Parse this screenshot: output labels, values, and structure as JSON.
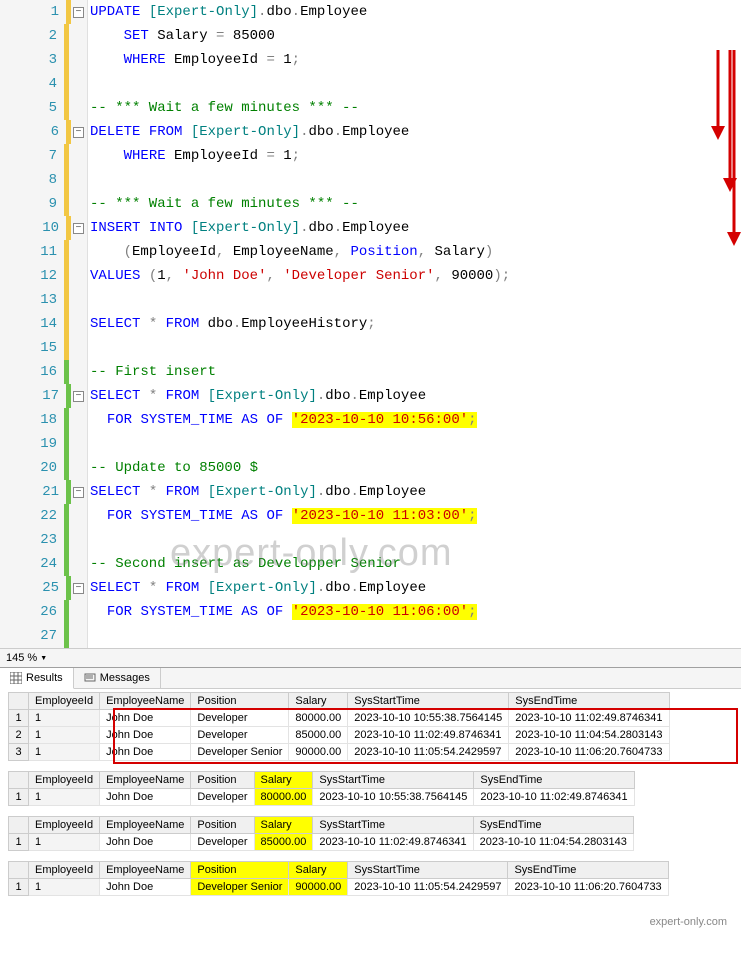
{
  "lines": [
    {
      "n": 1,
      "bar": "y",
      "fold": true,
      "seg": [
        {
          "t": "UPDATE",
          "c": "kw"
        },
        {
          "t": " ",
          "c": ""
        },
        {
          "t": "[Expert-Only]",
          "c": "tl"
        },
        {
          "t": ".",
          "c": "dot"
        },
        {
          "t": "dbo",
          "c": "nm"
        },
        {
          "t": ".",
          "c": "dot"
        },
        {
          "t": "Employee",
          "c": "nm"
        }
      ]
    },
    {
      "n": 2,
      "bar": "y",
      "seg": [
        {
          "t": "    ",
          "c": ""
        },
        {
          "t": "SET",
          "c": "kw"
        },
        {
          "t": " Salary ",
          "c": "nm"
        },
        {
          "t": "=",
          "c": "op"
        },
        {
          "t": " 85000",
          "c": "nm"
        }
      ]
    },
    {
      "n": 3,
      "bar": "y",
      "seg": [
        {
          "t": "    ",
          "c": ""
        },
        {
          "t": "WHERE",
          "c": "kw"
        },
        {
          "t": " EmployeeId ",
          "c": "nm"
        },
        {
          "t": "=",
          "c": "op"
        },
        {
          "t": " 1",
          "c": "nm"
        },
        {
          "t": ";",
          "c": "op"
        }
      ]
    },
    {
      "n": 4,
      "bar": "y",
      "seg": []
    },
    {
      "n": 5,
      "bar": "y",
      "seg": [
        {
          "t": "-- *** Wait a few minutes *** --",
          "c": "cmt"
        }
      ]
    },
    {
      "n": 6,
      "bar": "y",
      "fold": true,
      "seg": [
        {
          "t": "DELETE",
          "c": "kw"
        },
        {
          "t": " ",
          "c": ""
        },
        {
          "t": "FROM",
          "c": "kw"
        },
        {
          "t": " ",
          "c": ""
        },
        {
          "t": "[Expert-Only]",
          "c": "tl"
        },
        {
          "t": ".",
          "c": "dot"
        },
        {
          "t": "dbo",
          "c": "nm"
        },
        {
          "t": ".",
          "c": "dot"
        },
        {
          "t": "Employee",
          "c": "nm"
        }
      ]
    },
    {
      "n": 7,
      "bar": "y",
      "seg": [
        {
          "t": "    ",
          "c": ""
        },
        {
          "t": "WHERE",
          "c": "kw"
        },
        {
          "t": " EmployeeId ",
          "c": "nm"
        },
        {
          "t": "=",
          "c": "op"
        },
        {
          "t": " 1",
          "c": "nm"
        },
        {
          "t": ";",
          "c": "op"
        }
      ]
    },
    {
      "n": 8,
      "bar": "y",
      "seg": []
    },
    {
      "n": 9,
      "bar": "y",
      "seg": [
        {
          "t": "-- *** Wait a few minutes *** --",
          "c": "cmt"
        }
      ]
    },
    {
      "n": 10,
      "bar": "y",
      "fold": true,
      "seg": [
        {
          "t": "INSERT",
          "c": "kw"
        },
        {
          "t": " ",
          "c": ""
        },
        {
          "t": "INTO",
          "c": "kw"
        },
        {
          "t": " ",
          "c": ""
        },
        {
          "t": "[Expert-Only]",
          "c": "tl"
        },
        {
          "t": ".",
          "c": "dot"
        },
        {
          "t": "dbo",
          "c": "nm"
        },
        {
          "t": ".",
          "c": "dot"
        },
        {
          "t": "Employee",
          "c": "nm"
        }
      ]
    },
    {
      "n": 11,
      "bar": "y",
      "seg": [
        {
          "t": "    ",
          "c": ""
        },
        {
          "t": "(",
          "c": "op"
        },
        {
          "t": "EmployeeId",
          "c": "nm"
        },
        {
          "t": ",",
          "c": "op"
        },
        {
          "t": " EmployeeName",
          "c": "nm"
        },
        {
          "t": ",",
          "c": "op"
        },
        {
          "t": " ",
          "c": ""
        },
        {
          "t": "Position",
          "c": "kw"
        },
        {
          "t": ",",
          "c": "op"
        },
        {
          "t": " Salary",
          "c": "nm"
        },
        {
          "t": ")",
          "c": "op"
        }
      ]
    },
    {
      "n": 12,
      "bar": "y",
      "seg": [
        {
          "t": "VALUES",
          "c": "kw"
        },
        {
          "t": " ",
          "c": ""
        },
        {
          "t": "(",
          "c": "op"
        },
        {
          "t": "1",
          "c": "nm"
        },
        {
          "t": ",",
          "c": "op"
        },
        {
          "t": " ",
          "c": ""
        },
        {
          "t": "'John Doe'",
          "c": "str"
        },
        {
          "t": ",",
          "c": "op"
        },
        {
          "t": " ",
          "c": ""
        },
        {
          "t": "'Developer Senior'",
          "c": "str"
        },
        {
          "t": ",",
          "c": "op"
        },
        {
          "t": " 90000",
          "c": "nm"
        },
        {
          "t": ")",
          "c": "op"
        },
        {
          "t": ";",
          "c": "op"
        }
      ]
    },
    {
      "n": 13,
      "bar": "y",
      "seg": []
    },
    {
      "n": 14,
      "bar": "y",
      "seg": [
        {
          "t": "SELECT",
          "c": "kw"
        },
        {
          "t": " ",
          "c": ""
        },
        {
          "t": "*",
          "c": "op"
        },
        {
          "t": " ",
          "c": ""
        },
        {
          "t": "FROM",
          "c": "kw"
        },
        {
          "t": " dbo",
          "c": "nm"
        },
        {
          "t": ".",
          "c": "dot"
        },
        {
          "t": "EmployeeHistory",
          "c": "nm"
        },
        {
          "t": ";",
          "c": "op"
        }
      ]
    },
    {
      "n": 15,
      "bar": "y",
      "seg": []
    },
    {
      "n": 16,
      "bar": "g",
      "seg": [
        {
          "t": "-- First insert",
          "c": "cmt"
        }
      ]
    },
    {
      "n": 17,
      "bar": "g",
      "fold": true,
      "seg": [
        {
          "t": "SELECT",
          "c": "kw"
        },
        {
          "t": " ",
          "c": ""
        },
        {
          "t": "*",
          "c": "op"
        },
        {
          "t": " ",
          "c": ""
        },
        {
          "t": "FROM",
          "c": "kw"
        },
        {
          "t": " ",
          "c": ""
        },
        {
          "t": "[Expert-Only]",
          "c": "tl"
        },
        {
          "t": ".",
          "c": "dot"
        },
        {
          "t": "dbo",
          "c": "nm"
        },
        {
          "t": ".",
          "c": "dot"
        },
        {
          "t": "Employee",
          "c": "nm"
        }
      ]
    },
    {
      "n": 18,
      "bar": "g",
      "seg": [
        {
          "t": "  ",
          "c": ""
        },
        {
          "t": "FOR",
          "c": "kw"
        },
        {
          "t": " ",
          "c": ""
        },
        {
          "t": "SYSTEM_TIME",
          "c": "kw"
        },
        {
          "t": " ",
          "c": ""
        },
        {
          "t": "AS",
          "c": "kw"
        },
        {
          "t": " ",
          "c": ""
        },
        {
          "t": "OF",
          "c": "kw"
        },
        {
          "t": " ",
          "c": ""
        },
        {
          "t": "'2023-10-10 10:56:00'",
          "c": "str",
          "hl": true
        },
        {
          "t": ";",
          "c": "op",
          "hl": true
        }
      ]
    },
    {
      "n": 19,
      "bar": "g",
      "seg": []
    },
    {
      "n": 20,
      "bar": "g",
      "seg": [
        {
          "t": "-- Update to 85000 $",
          "c": "cmt"
        }
      ]
    },
    {
      "n": 21,
      "bar": "g",
      "fold": true,
      "seg": [
        {
          "t": "SELECT",
          "c": "kw"
        },
        {
          "t": " ",
          "c": ""
        },
        {
          "t": "*",
          "c": "op"
        },
        {
          "t": " ",
          "c": ""
        },
        {
          "t": "FROM",
          "c": "kw"
        },
        {
          "t": " ",
          "c": ""
        },
        {
          "t": "[Expert-Only]",
          "c": "tl"
        },
        {
          "t": ".",
          "c": "dot"
        },
        {
          "t": "dbo",
          "c": "nm"
        },
        {
          "t": ".",
          "c": "dot"
        },
        {
          "t": "Employee",
          "c": "nm"
        }
      ]
    },
    {
      "n": 22,
      "bar": "g",
      "seg": [
        {
          "t": "  ",
          "c": ""
        },
        {
          "t": "FOR",
          "c": "kw"
        },
        {
          "t": " ",
          "c": ""
        },
        {
          "t": "SYSTEM_TIME",
          "c": "kw"
        },
        {
          "t": " ",
          "c": ""
        },
        {
          "t": "AS",
          "c": "kw"
        },
        {
          "t": " ",
          "c": ""
        },
        {
          "t": "OF",
          "c": "kw"
        },
        {
          "t": " ",
          "c": ""
        },
        {
          "t": "'2023-10-10 11:03:00'",
          "c": "str",
          "hl": true
        },
        {
          "t": ";",
          "c": "op",
          "hl": true
        }
      ]
    },
    {
      "n": 23,
      "bar": "g",
      "seg": []
    },
    {
      "n": 24,
      "bar": "g",
      "seg": [
        {
          "t": "-- Second insert as Developper Senior",
          "c": "cmt"
        }
      ]
    },
    {
      "n": 25,
      "bar": "g",
      "fold": true,
      "seg": [
        {
          "t": "SELECT",
          "c": "kw"
        },
        {
          "t": " ",
          "c": ""
        },
        {
          "t": "*",
          "c": "op"
        },
        {
          "t": " ",
          "c": ""
        },
        {
          "t": "FROM",
          "c": "kw"
        },
        {
          "t": " ",
          "c": ""
        },
        {
          "t": "[Expert-Only]",
          "c": "tl"
        },
        {
          "t": ".",
          "c": "dot"
        },
        {
          "t": "dbo",
          "c": "nm"
        },
        {
          "t": ".",
          "c": "dot"
        },
        {
          "t": "Employee",
          "c": "nm"
        }
      ]
    },
    {
      "n": 26,
      "bar": "g",
      "seg": [
        {
          "t": "  ",
          "c": ""
        },
        {
          "t": "FOR",
          "c": "kw"
        },
        {
          "t": " ",
          "c": ""
        },
        {
          "t": "SYSTEM_TIME",
          "c": "kw"
        },
        {
          "t": " ",
          "c": ""
        },
        {
          "t": "AS",
          "c": "kw"
        },
        {
          "t": " ",
          "c": ""
        },
        {
          "t": "OF",
          "c": "kw"
        },
        {
          "t": " ",
          "c": ""
        },
        {
          "t": "'2023-10-10 11:06:00'",
          "c": "str",
          "hl": true
        },
        {
          "t": ";",
          "c": "op",
          "hl": true
        }
      ]
    },
    {
      "n": 27,
      "bar": "g",
      "seg": []
    }
  ],
  "zoom": "145 %",
  "tabs": {
    "results": "Results",
    "messages": "Messages"
  },
  "headers": [
    "EmployeeId",
    "EmployeeName",
    "Position",
    "Salary",
    "SysStartTime",
    "SysEndTime"
  ],
  "grid1": [
    [
      "1",
      "John Doe",
      "Developer",
      "80000.00",
      "2023-10-10 10:55:38.7564145",
      "2023-10-10 11:02:49.8746341"
    ],
    [
      "1",
      "John Doe",
      "Developer",
      "85000.00",
      "2023-10-10 11:02:49.8746341",
      "2023-10-10 11:04:54.2803143"
    ],
    [
      "1",
      "John Doe",
      "Developer Senior",
      "90000.00",
      "2023-10-10 11:05:54.2429597",
      "2023-10-10 11:06:20.7604733"
    ]
  ],
  "grid2": [
    [
      "1",
      "John Doe",
      "Developer",
      "80000.00",
      "2023-10-10 10:55:38.7564145",
      "2023-10-10 11:02:49.8746341"
    ]
  ],
  "grid3": [
    [
      "1",
      "John Doe",
      "Developer",
      "85000.00",
      "2023-10-10 11:02:49.8746341",
      "2023-10-10 11:04:54.2803143"
    ]
  ],
  "grid4": [
    [
      "1",
      "John Doe",
      "Developer Senior",
      "90000.00",
      "2023-10-10 11:05:54.2429597",
      "2023-10-10 11:06:20.7604733"
    ]
  ],
  "footer": "expert-only.com",
  "watermark": "expert-only.com"
}
